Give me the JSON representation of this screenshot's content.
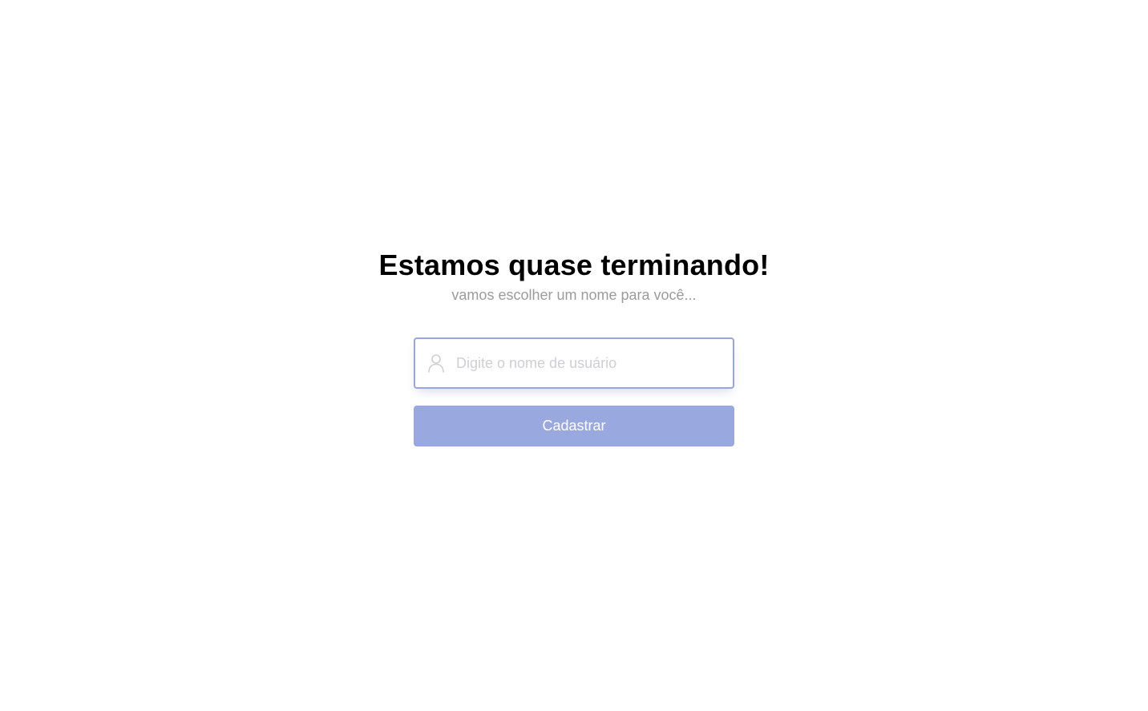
{
  "heading": {
    "title": "Estamos quase terminando!",
    "subtitle": "vamos escolher um nome para você..."
  },
  "form": {
    "username": {
      "value": "",
      "placeholder": "Digite o nome de usuário",
      "icon": "user-icon"
    },
    "submit_label": "Cadastrar"
  },
  "colors": {
    "accent": "#9aa8e0",
    "input_border": "#99a6dc",
    "subtitle": "#9b9b9b",
    "placeholder": "#cfcfd4"
  }
}
